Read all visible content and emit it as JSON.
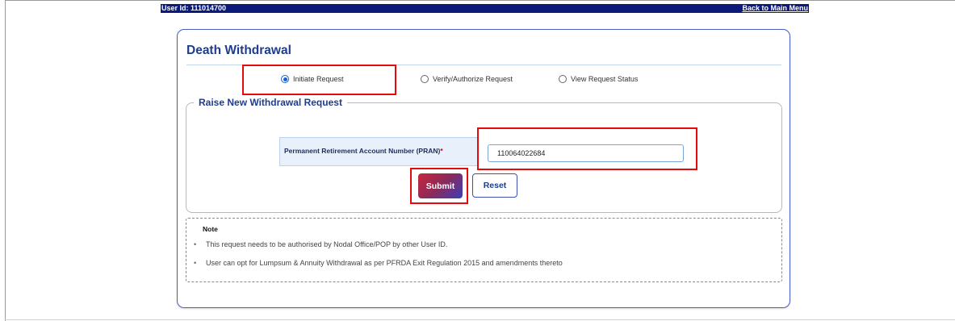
{
  "header": {
    "user_id": "User Id: 111014700",
    "back_link": "Back to Main Menu"
  },
  "page": {
    "title": "Death Withdrawal"
  },
  "options": [
    {
      "label": "Initiate Request",
      "checked": true
    },
    {
      "label": "Verify/Authorize Request",
      "checked": false
    },
    {
      "label": "View Request Status",
      "checked": false
    }
  ],
  "form": {
    "legend": "Raise New Withdrawal Request",
    "pran_label": "Permanent Retirement Account Number (PRAN)",
    "required_mark": "*",
    "pran_value": "110064022684",
    "submit_label": "Submit",
    "reset_label": "Reset"
  },
  "note": {
    "title": "Note",
    "items": [
      "This request needs to be authorised by Nodal Office/POP by other User ID.",
      "User can opt for Lumpsum & Annuity Withdrawal as per PFRDA Exit Regulation 2015 and amendments thereto"
    ]
  },
  "colors": {
    "header_bg": "#0c1a7a",
    "title": "#1f3d8c",
    "annotation": "#e30b0b"
  }
}
